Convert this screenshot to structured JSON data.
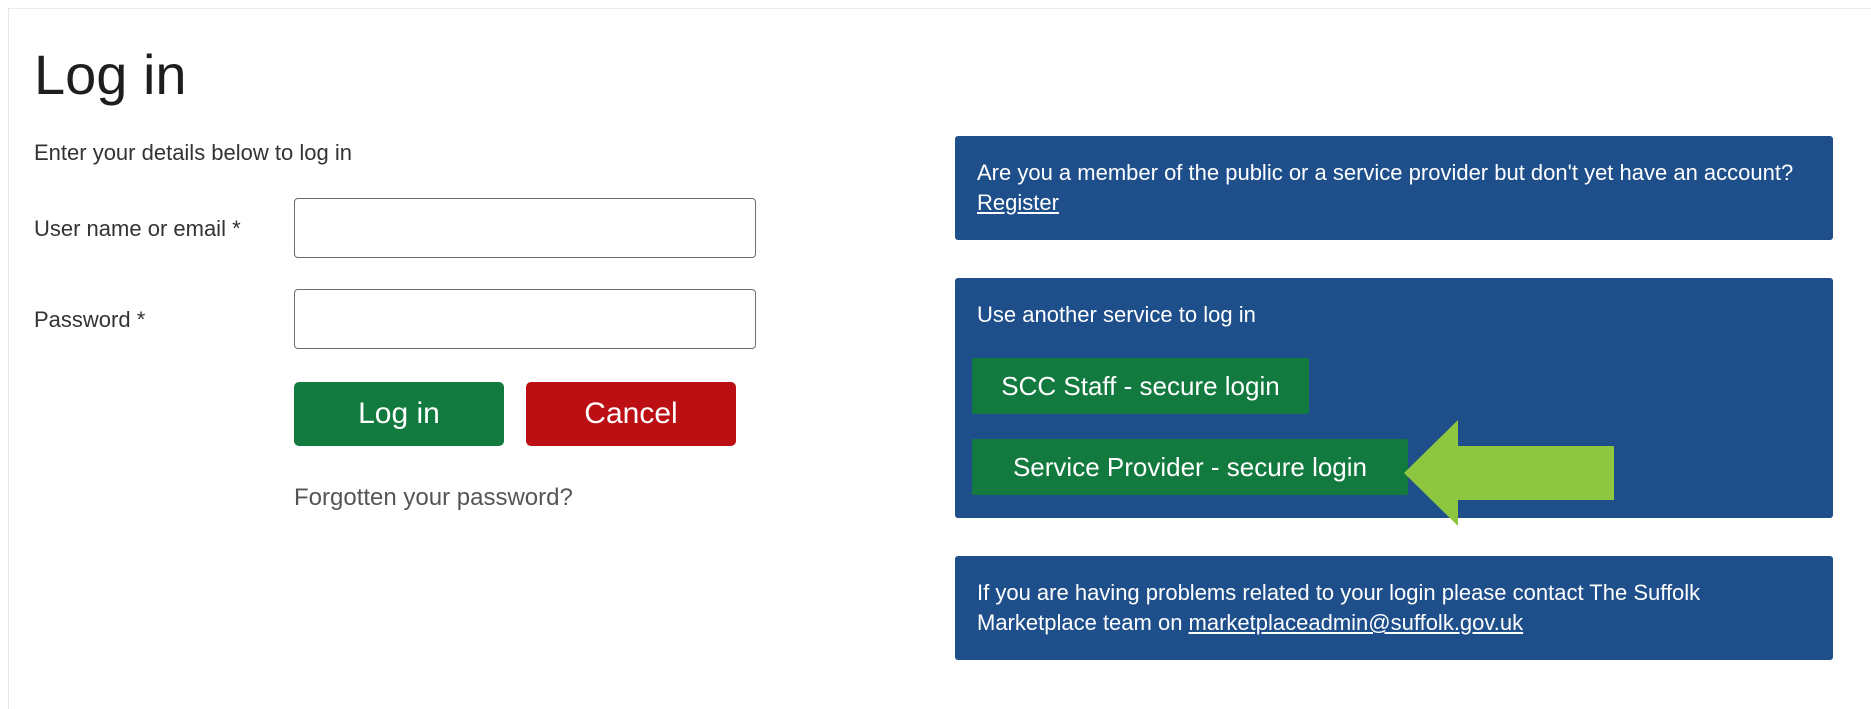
{
  "page": {
    "title": "Log in",
    "intro": "Enter your details below to log in"
  },
  "form": {
    "username_label": "User name or email *",
    "username_value": "",
    "password_label": "Password *",
    "password_value": "",
    "login_button": "Log in",
    "cancel_button": "Cancel",
    "forgot_link": "Forgotten your password?"
  },
  "register_panel": {
    "text": "Are you a member of the public or a service provider but don't yet have an account? ",
    "link": "Register"
  },
  "services_panel": {
    "heading": "Use another service to log in",
    "buttons": [
      {
        "label": "SCC Staff - secure login"
      },
      {
        "label": "Service Provider - secure login"
      }
    ]
  },
  "contact_panel": {
    "text": "If you are having problems related to your login please contact The Suffolk Marketplace team on ",
    "email": "marketplaceadmin@suffolk.gov.uk"
  },
  "annotation": {
    "arrow_color": "#8dc63f",
    "arrow_icon": "left-arrow-icon"
  },
  "colors": {
    "primary_green": "#127a3f",
    "cancel_red": "#bb0f14",
    "panel_blue": "#1f4f8a"
  }
}
